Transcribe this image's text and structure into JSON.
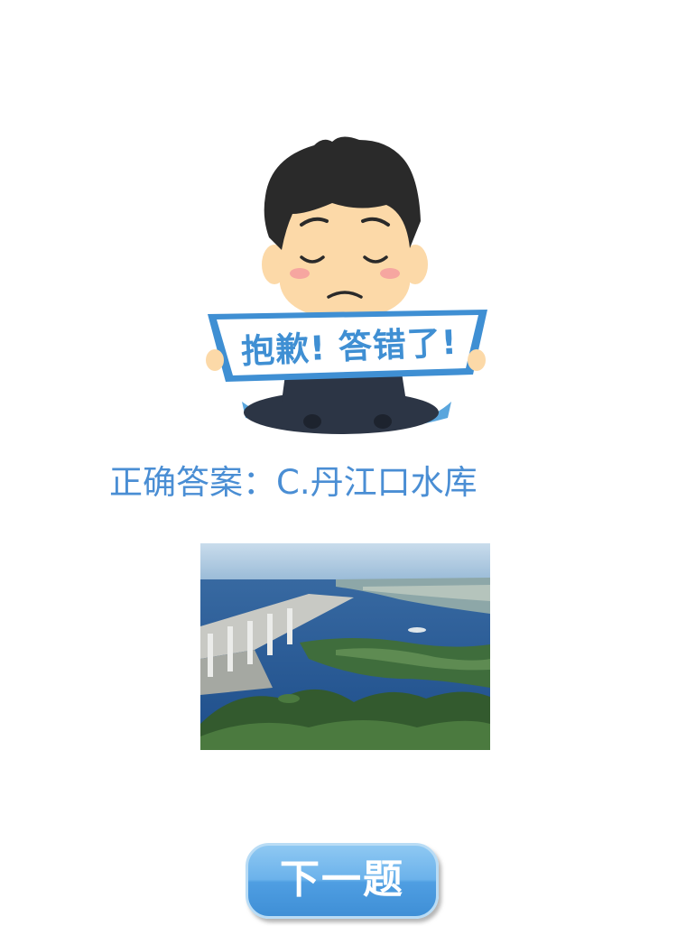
{
  "result": {
    "sign_text": "抱歉! 答错了!",
    "answer_text": "正确答案：C.丹江口水库"
  },
  "photo": {
    "subject": "dam-reservoir-aerial-photo"
  },
  "actions": {
    "next_label": "下一题"
  },
  "colors": {
    "accent": "#4a8ed4",
    "button_top": "#8ec8f2",
    "button_bottom": "#3f8fd6",
    "hair": "#2a2a2a",
    "skin": "#fcd9a8",
    "suit": "#2c3545"
  }
}
